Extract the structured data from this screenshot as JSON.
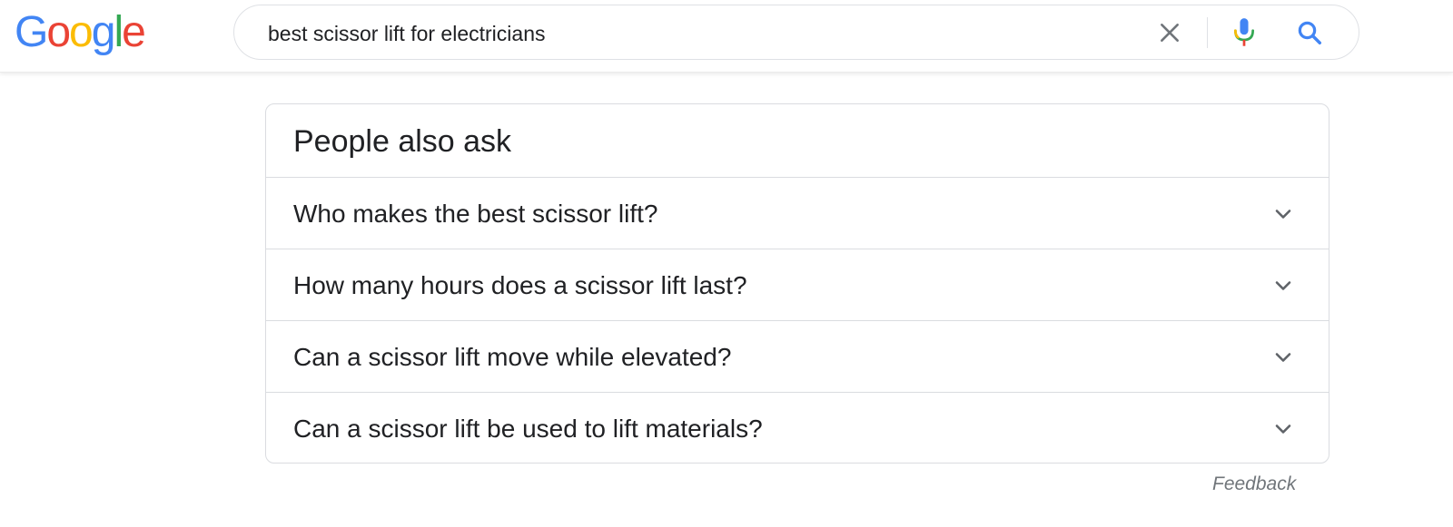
{
  "logo": {
    "letters": [
      "G",
      "o",
      "o",
      "g",
      "l",
      "e"
    ],
    "colors": [
      "#4285F4",
      "#EA4335",
      "#FBBC05",
      "#4285F4",
      "#34A853",
      "#EA4335"
    ]
  },
  "search": {
    "query": "best scissor lift for electricians",
    "icons": [
      "close-icon",
      "microphone-icon",
      "search-icon"
    ]
  },
  "people_also_ask": {
    "title": "People also ask",
    "questions": [
      "Who makes the best scissor lift?",
      "How many hours does a scissor lift last?",
      "Can a scissor lift move while elevated?",
      "Can a scissor lift be used to lift materials?"
    ],
    "expand_icon": "chevron-down-icon"
  },
  "feedback": "Feedback",
  "colors": {
    "text": "#202124",
    "secondary": "#70757a",
    "border": "#dadce0",
    "icon_gray": "#5f6368",
    "blue": "#4285F4"
  }
}
